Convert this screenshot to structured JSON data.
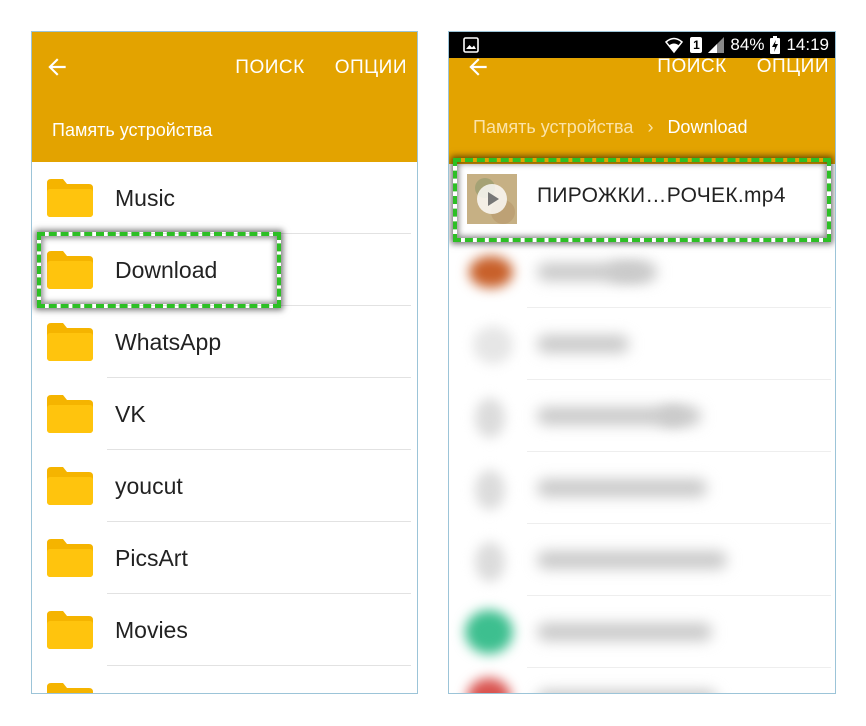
{
  "left_screen": {
    "appbar": {
      "search_label": "ПОИСК",
      "options_label": "ОПЦИИ",
      "path": "Память устройства"
    },
    "folders": [
      {
        "label": "Music"
      },
      {
        "label": "Download"
      },
      {
        "label": "WhatsApp"
      },
      {
        "label": "VK"
      },
      {
        "label": "youcut"
      },
      {
        "label": "PicsArt"
      },
      {
        "label": "Movies"
      }
    ],
    "highlighted": "Download"
  },
  "right_screen": {
    "status_bar": {
      "battery": "84%",
      "time": "14:19",
      "sim_label": "1"
    },
    "appbar": {
      "search_label": "ПОИСК",
      "options_label": "ОПЦИИ",
      "path_root": "Память устройства",
      "path_current": "Download"
    },
    "file": {
      "label": "ПИРОЖКИ…РОЧЕК.mp4"
    }
  },
  "colors": {
    "appbar": "#e3a300",
    "folder": "#ffc40d",
    "highlight": "#2dbf25"
  }
}
